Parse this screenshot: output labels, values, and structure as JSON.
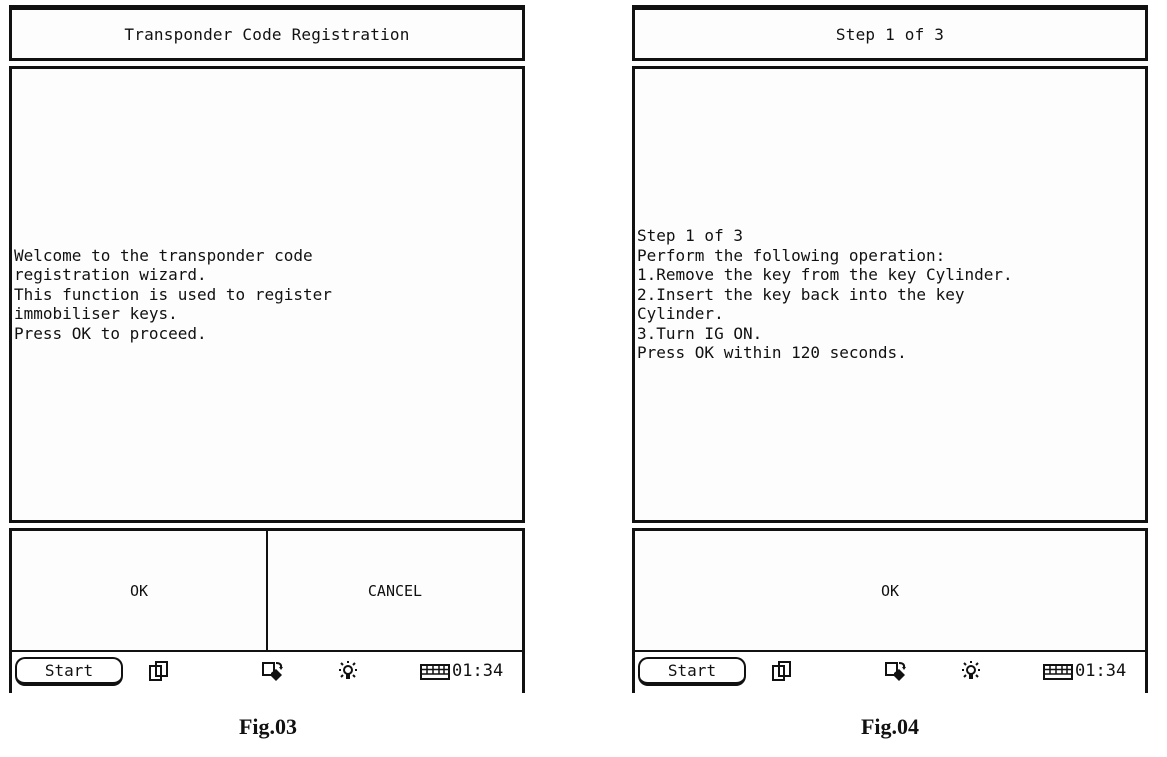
{
  "figures": [
    {
      "header_title": "Transponder Code Registration",
      "message": "Welcome to the transponder code\nregistration wizard.\nThis function is used to register\nimmobiliser keys.\nPress OK to proceed.",
      "buttons": [
        "OK",
        "CANCEL"
      ],
      "taskbar": {
        "start_label": "Start",
        "icons": [
          "windows-icon",
          "sync-icon",
          "brightness-icon",
          "keyboard-icon"
        ],
        "clock": "01:34"
      },
      "caption": "Fig.03"
    },
    {
      "header_title": "Step 1 of 3",
      "message": "Step 1 of 3\nPerform the following operation:\n1.Remove the key from the key Cylinder.\n2.Insert the key back into the key\nCylinder.\n3.Turn IG ON.\nPress OK within 120 seconds.",
      "buttons": [
        "OK"
      ],
      "taskbar": {
        "start_label": "Start",
        "icons": [
          "windows-icon",
          "sync-icon",
          "brightness-icon",
          "keyboard-icon"
        ],
        "clock": "01:34"
      },
      "caption": "Fig.04"
    }
  ]
}
